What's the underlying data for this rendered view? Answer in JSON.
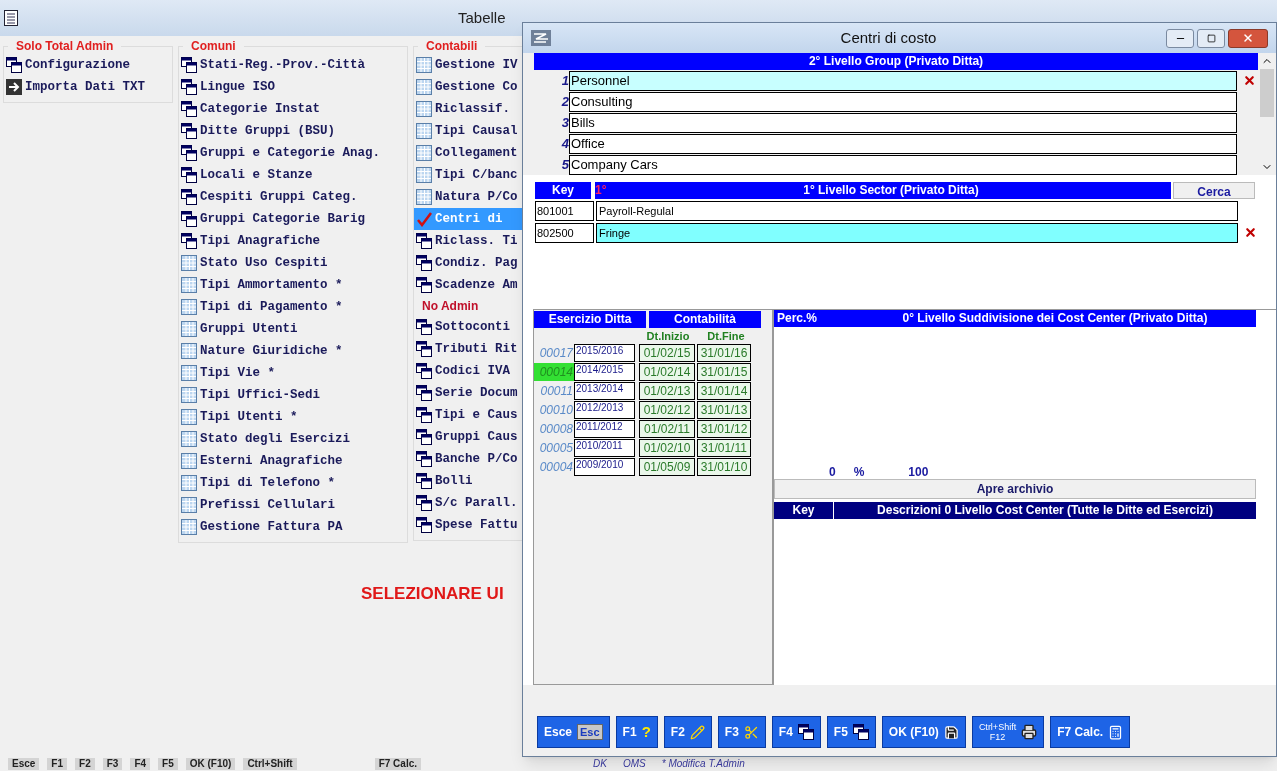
{
  "main_window": {
    "title": "Tabelle",
    "sections": [
      {
        "title": "Solo Total Admin",
        "items": [
          {
            "label": "Configurazione",
            "kind": "window",
            "selected": false
          },
          {
            "label": "Importa Dati TXT",
            "kind": "import",
            "selected": false
          }
        ]
      },
      {
        "title": "Comuni",
        "items": [
          {
            "label": "Stati-Reg.-Prov.-Città",
            "kind": "window",
            "selected": false
          },
          {
            "label": "Lingue ISO",
            "kind": "window",
            "selected": false
          },
          {
            "label": "Categorie Instat",
            "kind": "window",
            "selected": false
          },
          {
            "label": "Ditte Gruppi (BSU)",
            "kind": "window",
            "selected": false
          },
          {
            "label": "Gruppi e Categorie Anag.",
            "kind": "window",
            "selected": false
          },
          {
            "label": "Locali e Stanze",
            "kind": "window",
            "selected": false
          },
          {
            "label": "Cespiti Gruppi Categ.",
            "kind": "window",
            "selected": false
          },
          {
            "label": "Gruppi Categorie Barig",
            "kind": "window",
            "selected": false
          },
          {
            "label": "Tipi Anagrafiche",
            "kind": "window",
            "selected": false
          },
          {
            "label": "Stato Uso Cespiti",
            "kind": "table",
            "selected": false
          },
          {
            "label": "Tipi Ammortamento *",
            "kind": "table",
            "selected": false
          },
          {
            "label": "Tipi di Pagamento *",
            "kind": "table",
            "selected": false
          },
          {
            "label": "Gruppi Utenti",
            "kind": "table",
            "selected": false
          },
          {
            "label": "Nature Giuridiche *",
            "kind": "table",
            "selected": false
          },
          {
            "label": "Tipi Vie *",
            "kind": "table",
            "selected": false
          },
          {
            "label": "Tipi Uffici-Sedi",
            "kind": "table",
            "selected": false
          },
          {
            "label": "Tipi Utenti *",
            "kind": "table",
            "selected": false
          },
          {
            "label": "Stato degli Esercizi",
            "kind": "table",
            "selected": false
          },
          {
            "label": "Esterni Anagrafiche",
            "kind": "table",
            "selected": false
          },
          {
            "label": "Tipi di Telefono *",
            "kind": "table",
            "selected": false
          },
          {
            "label": "Prefissi Cellulari",
            "kind": "table",
            "selected": false
          },
          {
            "label": "Gestione Fattura PA",
            "kind": "table",
            "selected": false
          }
        ]
      },
      {
        "title": "Contabili",
        "items": [
          {
            "label": "Gestione IV",
            "kind": "table",
            "selected": false
          },
          {
            "label": "Gestione Co",
            "kind": "table",
            "selected": false
          },
          {
            "label": "Riclassif.",
            "kind": "table",
            "selected": false
          },
          {
            "label": "Tipi Causal",
            "kind": "table",
            "selected": false
          },
          {
            "label": "Collegament",
            "kind": "table",
            "selected": false
          },
          {
            "label": "Tipi C/banc",
            "kind": "table",
            "selected": false
          },
          {
            "label": "Natura P/Co",
            "kind": "table",
            "selected": false
          },
          {
            "label": "Centri di",
            "kind": "check",
            "selected": true
          },
          {
            "label": "Riclass. Ti",
            "kind": "window",
            "selected": false
          },
          {
            "label": "Condiz. Pag",
            "kind": "window",
            "selected": false
          },
          {
            "label": "Scadenze Am",
            "kind": "window",
            "selected": false
          },
          {
            "kind": "heading",
            "label": "No Admin"
          },
          {
            "label": "Sottoconti",
            "kind": "window",
            "selected": false
          },
          {
            "label": "Tributi Rit",
            "kind": "window",
            "selected": false
          },
          {
            "label": "Codici IVA",
            "kind": "window",
            "selected": false
          },
          {
            "label": "Serie Docum",
            "kind": "window",
            "selected": false
          },
          {
            "label": "Tipi e Caus",
            "kind": "window",
            "selected": false
          },
          {
            "label": "Gruppi Caus",
            "kind": "window",
            "selected": false
          },
          {
            "label": "Banche P/Co",
            "kind": "window",
            "selected": false
          },
          {
            "label": "Bolli",
            "kind": "window",
            "selected": false
          },
          {
            "label": "S/c Parall.",
            "kind": "window",
            "selected": false
          },
          {
            "label": "Spese Fattu",
            "kind": "window",
            "selected": false
          }
        ]
      }
    ],
    "message": "SELEZIONARE UI",
    "bottom_bar": [
      "Esce",
      "F1",
      "F2",
      "F3",
      "F4",
      "F5",
      "OK (F10)",
      "Ctrl+Shift",
      "F7 Calc.",
      "DK",
      "OMS",
      "* Modifica T.Admin"
    ]
  },
  "dialog": {
    "title": "Centri di costo",
    "group": {
      "header": "2° Livello Group (Privato Ditta)",
      "rows": [
        {
          "number": "1",
          "name": "Personnel",
          "selected": true
        },
        {
          "number": "2",
          "name": "Consulting",
          "selected": false
        },
        {
          "number": "3",
          "name": "Bills",
          "selected": false
        },
        {
          "number": "4",
          "name": "Office",
          "selected": false
        },
        {
          "number": "5",
          "name": "Company Cars",
          "selected": false
        }
      ]
    },
    "sector": {
      "key_header": "Key",
      "level_header": "1°",
      "header": "1° Livello Sector (Privato Ditta)",
      "search_button": "Cerca",
      "rows": [
        {
          "key": "801001",
          "name": "Payroll-Regulal",
          "selected": false
        },
        {
          "key": "802500",
          "name": "Fringe",
          "selected": true
        }
      ]
    },
    "years": {
      "header": "Esercizio Ditta",
      "accounting_header": "Contabilità",
      "start_header": "Dt.Inizio",
      "end_header": "Dt.Fine",
      "rows": [
        {
          "code": "00017",
          "period": "2015/2016",
          "start": "01/02/15",
          "end": "31/01/16",
          "selected": false
        },
        {
          "code": "00014",
          "period": "2014/2015",
          "start": "01/02/14",
          "end": "31/01/15",
          "selected": true
        },
        {
          "code": "00011",
          "period": "2013/2014",
          "start": "01/02/13",
          "end": "31/01/14",
          "selected": false
        },
        {
          "code": "00010",
          "period": "2012/2013",
          "start": "01/02/12",
          "end": "31/01/13",
          "selected": false
        },
        {
          "code": "00008",
          "period": "2011/2012",
          "start": "01/02/11",
          "end": "31/01/12",
          "selected": false
        },
        {
          "code": "00005",
          "period": "2010/2011",
          "start": "01/02/10",
          "end": "31/01/11",
          "selected": false
        },
        {
          "code": "00004",
          "period": "2009/2010",
          "start": "01/05/09",
          "end": "31/01/10",
          "selected": false
        }
      ]
    },
    "subdivision": {
      "perc_header": "Perc.%",
      "header": "0° Livello Suddivisione dei Cost Center (Privato Ditta)",
      "total": "0",
      "percent_sign": "%",
      "max": "100",
      "archive_button": "Apre archivio",
      "archive_key_header": "Key",
      "archive_header": "Descrizioni 0 Livello Cost Center (Tutte le Ditte ed Esercizi)"
    },
    "toolbar": [
      {
        "label": "Esce",
        "key": "Esc",
        "kind": "key"
      },
      {
        "label": "F1",
        "key": "?",
        "kind": "glyph"
      },
      {
        "label": "F2",
        "kind": "pencil"
      },
      {
        "label": "F3",
        "kind": "scissors"
      },
      {
        "label": "F4",
        "kind": "window"
      },
      {
        "label": "F5",
        "kind": "window"
      },
      {
        "label": "OK (F10)",
        "kind": "disk"
      },
      {
        "label": "Ctrl+Shift",
        "key": "F12",
        "kind": "printer"
      },
      {
        "label": "F7 Calc.",
        "kind": "calculator"
      }
    ]
  }
}
